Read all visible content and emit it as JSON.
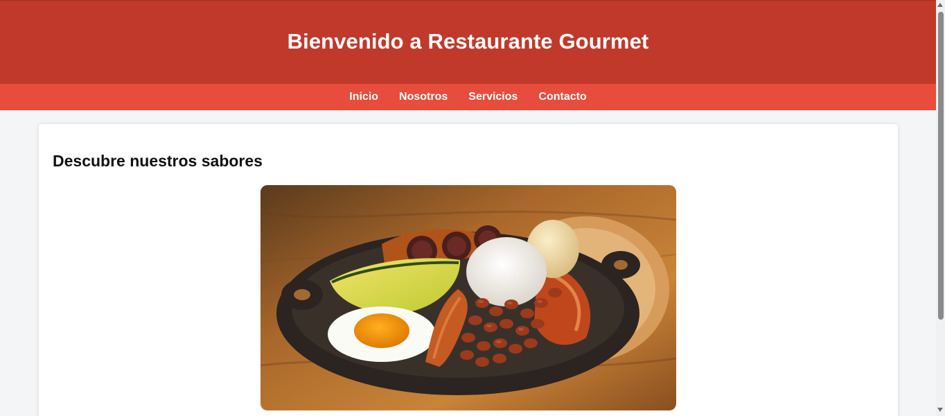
{
  "header": {
    "title": "Bienvenido a Restaurante Gourmet"
  },
  "nav": {
    "items": [
      {
        "label": "Inicio"
      },
      {
        "label": "Nosotros"
      },
      {
        "label": "Servicios"
      },
      {
        "label": "Contacto"
      }
    ]
  },
  "main": {
    "heading": "Descubre nuestros sabores",
    "image_alt": "bandeja-paisa-dish"
  },
  "colors": {
    "header_bg": "#c0392b",
    "nav_bg": "#e74c3c",
    "page_bg": "#f4f5f6",
    "card_bg": "#ffffff"
  }
}
